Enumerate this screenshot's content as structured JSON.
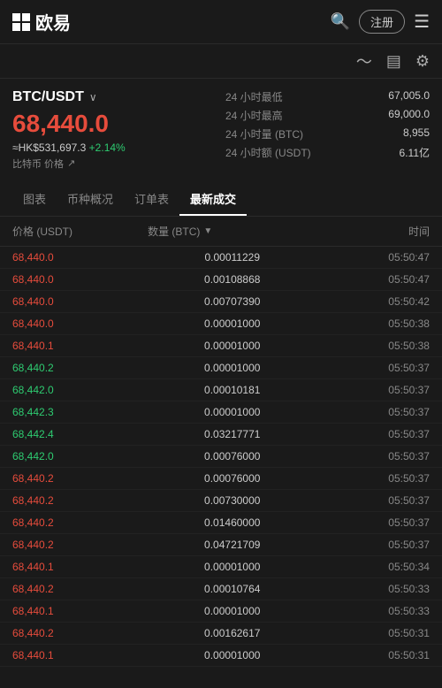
{
  "header": {
    "logo_text": "欧易",
    "register_label": "注册",
    "menu_label": "≡"
  },
  "pair": {
    "name": "BTC/USDT",
    "main_price": "68,440.0",
    "hk_price": "≈HK$531,697.3",
    "change_pct": "+2.14%",
    "btc_label": "比特币 价格"
  },
  "stats": [
    {
      "label": "24 小时最低",
      "value": "67,005.0"
    },
    {
      "label": "24 小时最高",
      "value": "69,000.0"
    },
    {
      "label": "24 小时量 (BTC)",
      "value": "8,955"
    },
    {
      "label": "24 小时额 (USDT)",
      "value": "6.11亿"
    }
  ],
  "tabs": [
    {
      "id": "chart",
      "label": "图表"
    },
    {
      "id": "overview",
      "label": "币种概况"
    },
    {
      "id": "orders",
      "label": "订单表"
    },
    {
      "id": "trades",
      "label": "最新成交",
      "active": true
    }
  ],
  "table_header": {
    "price_col": "价格 (USDT)",
    "amount_col": "数量 (BTC)",
    "time_col": "时间"
  },
  "trades": [
    {
      "price": "68,440.0",
      "side": "sell",
      "amount": "0.00011229",
      "time": "05:50:47"
    },
    {
      "price": "68,440.0",
      "side": "sell",
      "amount": "0.00108868",
      "time": "05:50:47"
    },
    {
      "price": "68,440.0",
      "side": "sell",
      "amount": "0.00707390",
      "time": "05:50:42"
    },
    {
      "price": "68,440.0",
      "side": "sell",
      "amount": "0.00001000",
      "time": "05:50:38"
    },
    {
      "price": "68,440.1",
      "side": "sell",
      "amount": "0.00001000",
      "time": "05:50:38"
    },
    {
      "price": "68,440.2",
      "side": "buy",
      "amount": "0.00001000",
      "time": "05:50:37"
    },
    {
      "price": "68,442.0",
      "side": "buy",
      "amount": "0.00010181",
      "time": "05:50:37"
    },
    {
      "price": "68,442.3",
      "side": "buy",
      "amount": "0.00001000",
      "time": "05:50:37"
    },
    {
      "price": "68,442.4",
      "side": "buy",
      "amount": "0.03217771",
      "time": "05:50:37"
    },
    {
      "price": "68,442.0",
      "side": "buy",
      "amount": "0.00076000",
      "time": "05:50:37"
    },
    {
      "price": "68,440.2",
      "side": "sell",
      "amount": "0.00076000",
      "time": "05:50:37"
    },
    {
      "price": "68,440.2",
      "side": "sell",
      "amount": "0.00730000",
      "time": "05:50:37"
    },
    {
      "price": "68,440.2",
      "side": "sell",
      "amount": "0.01460000",
      "time": "05:50:37"
    },
    {
      "price": "68,440.2",
      "side": "sell",
      "amount": "0.04721709",
      "time": "05:50:37"
    },
    {
      "price": "68,440.1",
      "side": "sell",
      "amount": "0.00001000",
      "time": "05:50:34"
    },
    {
      "price": "68,440.2",
      "side": "sell",
      "amount": "0.00010764",
      "time": "05:50:33"
    },
    {
      "price": "68,440.1",
      "side": "sell",
      "amount": "0.00001000",
      "time": "05:50:33"
    },
    {
      "price": "68,440.2",
      "side": "sell",
      "amount": "0.00162617",
      "time": "05:50:31"
    },
    {
      "price": "68,440.1",
      "side": "sell",
      "amount": "0.00001000",
      "time": "05:50:31"
    }
  ]
}
